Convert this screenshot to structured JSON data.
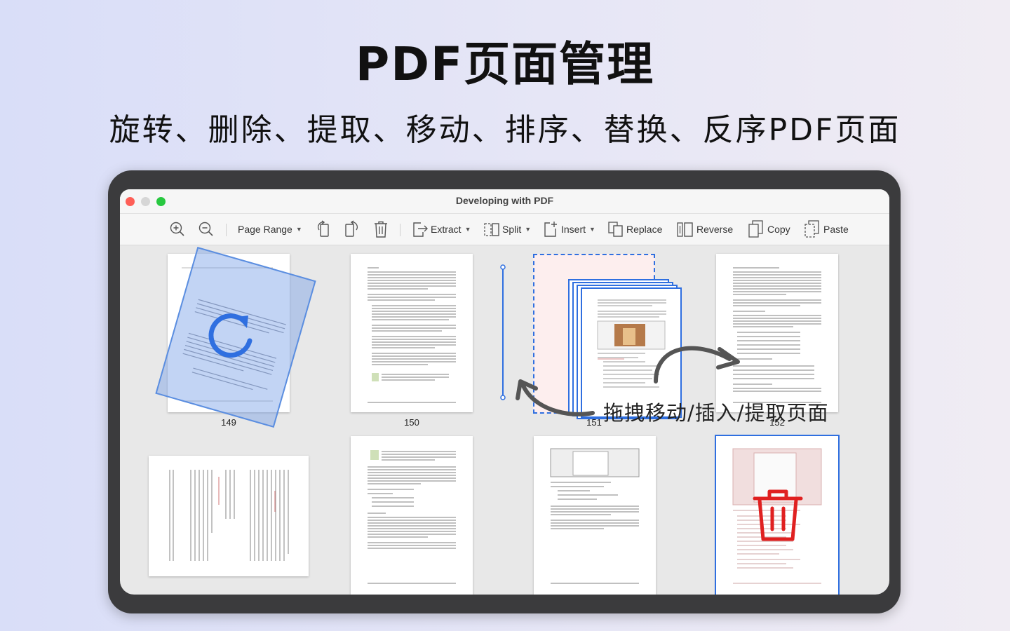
{
  "headline": "PDF页面管理",
  "subheadline": "旋转、删除、提取、移动、排序、替换、反序PDF页面",
  "window": {
    "title": "Developing with PDF"
  },
  "toolbar": {
    "page_range": "Page Range",
    "extract": "Extract",
    "split": "Split",
    "insert": "Insert",
    "replace": "Replace",
    "reverse": "Reverse",
    "copy": "Copy",
    "paste": "Paste"
  },
  "pages": {
    "p149": "149",
    "p150": "150",
    "p151": "151",
    "p152": "152"
  },
  "overlay": {
    "drag_caption": "拖拽移动/插入/提取页面"
  },
  "colors": {
    "accent_blue": "#2f6fe0",
    "delete_red": "#e02020",
    "device_frame": "#3b3b3d"
  },
  "icons": [
    "zoom-in-icon",
    "zoom-out-icon",
    "rotate-left-icon",
    "rotate-right-icon",
    "trash-icon",
    "extract-icon",
    "split-icon",
    "insert-icon",
    "replace-icon",
    "reverse-icon",
    "copy-icon",
    "paste-icon",
    "rotate-icon",
    "curved-arrow-icon",
    "delete-icon"
  ]
}
